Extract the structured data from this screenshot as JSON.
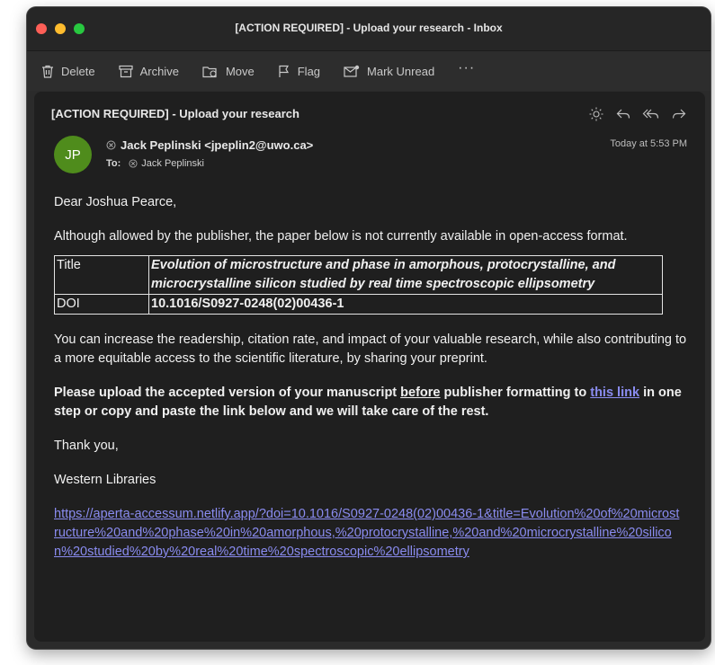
{
  "window": {
    "title": "[ACTION REQUIRED] - Upload your research - Inbox",
    "traffic_lights": [
      "#fe5f57",
      "#febc2e",
      "#28c840"
    ]
  },
  "toolbar": {
    "delete": "Delete",
    "archive": "Archive",
    "move": "Move",
    "flag": "Flag",
    "mark_unread": "Mark Unread",
    "more": "···"
  },
  "message": {
    "subject": "[ACTION REQUIRED] - Upload your research",
    "sender": {
      "initials": "JP",
      "avatar_color": "#4f8c1c",
      "name": "Jack Peplinski <jpeplin2@uwo.ca>"
    },
    "to_label": "To:",
    "recipient": "Jack Peplinski",
    "date": "Today at 5:53 PM",
    "greeting": "Dear Joshua Pearce,",
    "intro": "Although allowed by the publisher, the paper below is not currently available in open-access format.",
    "table": {
      "title_label": "Title",
      "title_value": "Evolution of microstructure and phase in amorphous, protocrystalline, and microcrystalline silicon studied by real time spectroscopic ellipsometry",
      "doi_label": "DOI",
      "doi_value": "10.1016/S0927-0248(02)00436-1"
    },
    "paragraph": "You can increase the readership, citation rate, and impact of your valuable research, while also contributing to a more equitable access to the scientific literature, by sharing your preprint.",
    "cta": {
      "part1": "Please upload the accepted version of your manuscript ",
      "before": "before",
      "part2": " publisher formatting to ",
      "link_text": "this link",
      "part3": " in one step or copy and paste the link below and we will take care of the rest."
    },
    "thanks": "Thank you,",
    "signature": "Western Libraries",
    "url": "https://aperta-accessum.netlify.app/?doi=10.1016/S0927-0248(02)00436-1&title=Evolution%20of%20microstructure%20and%20phase%20in%20amorphous,%20protocrystalline,%20and%20microcrystalline%20silicon%20studied%20by%20real%20time%20spectroscopic%20ellipsometry"
  }
}
